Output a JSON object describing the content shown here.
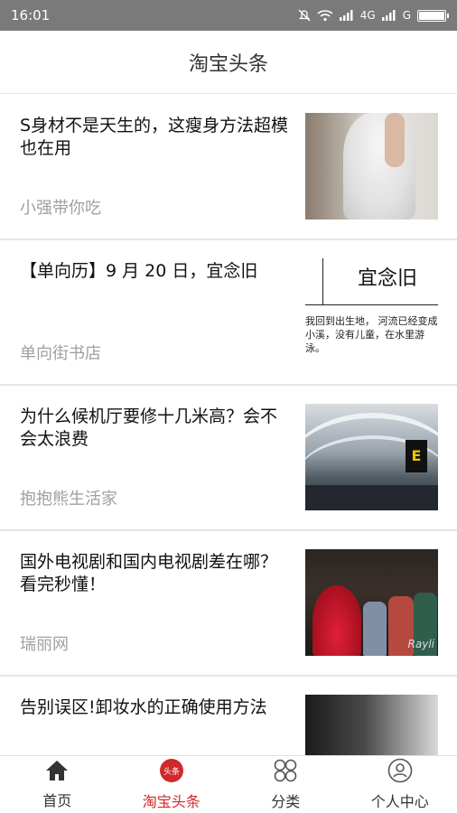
{
  "status": {
    "time": "16:01",
    "network1": "4G",
    "network2": "G"
  },
  "header": {
    "title": "淘宝头条"
  },
  "feed": [
    {
      "title": "S身材不是天生的，这瘦身方法超模也在用",
      "source": "小强带你吃"
    },
    {
      "title": "【单向历】9 月 20 日，宜念旧",
      "source": "单向街书店",
      "thumb_text": "宜念旧",
      "thumb_caption": "我回到出生地， 河流已经变成小溪，没有儿童，在水里游泳。"
    },
    {
      "title": "为什么候机厅要修十几米高？会不会太浪费",
      "source": "抱抱熊生活家",
      "thumb_sign": "E"
    },
    {
      "title": "国外电视剧和国内电视剧差在哪？看完秒懂！",
      "source": "瑞丽网",
      "thumb_watermark": "Rayli"
    },
    {
      "title": "告别误区!卸妆水的正确使用方法",
      "source": ""
    }
  ],
  "tabbar": {
    "items": [
      {
        "label": "首页",
        "icon": "home-icon"
      },
      {
        "label": "淘宝头条",
        "icon": "toutiao-icon",
        "badge": "头条"
      },
      {
        "label": "分类",
        "icon": "category-icon"
      },
      {
        "label": "个人中心",
        "icon": "profile-icon"
      }
    ],
    "active_color": "#d0282b"
  }
}
